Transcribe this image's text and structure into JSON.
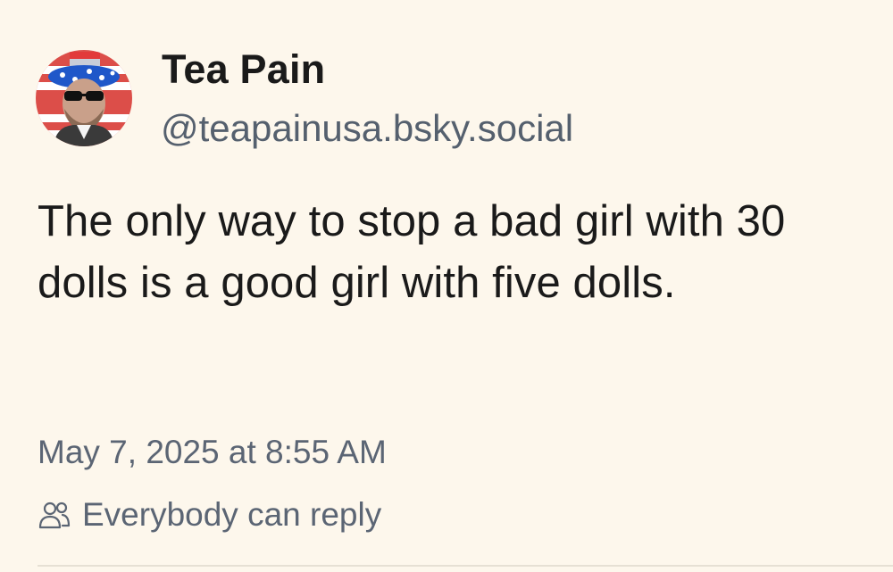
{
  "author": {
    "display_name": "Tea Pain",
    "handle": "@teapainusa.bsky.social",
    "avatar_icon": "avatar-photo"
  },
  "post": {
    "text": "The only way to stop a bad girl with 30 dolls is a good girl with five dolls.",
    "timestamp": "May 7, 2025 at 8:55 AM"
  },
  "reply_setting": {
    "icon": "people-icon",
    "label": "Everybody can reply"
  },
  "colors": {
    "background": "#fdf7ec",
    "text_primary": "#1a1a1a",
    "text_secondary": "#5b6574"
  }
}
